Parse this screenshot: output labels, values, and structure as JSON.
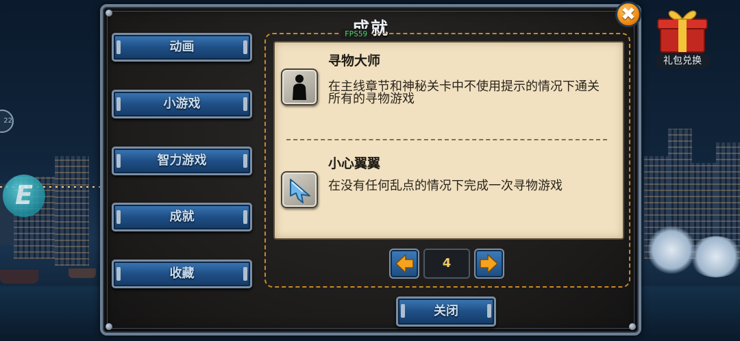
{
  "dialog": {
    "title": "成就",
    "close_icon_label": "✖",
    "fps_label": "FPS59"
  },
  "sidebar": {
    "items": [
      {
        "label": "动画"
      },
      {
        "label": "小游戏"
      },
      {
        "label": "智力游戏"
      },
      {
        "label": "成就"
      },
      {
        "label": "收藏"
      }
    ]
  },
  "achievements": [
    {
      "name": "寻物大师",
      "description": "在主线章节和神秘关卡中不使用提示的情况下通关所有的寻物游戏",
      "icon": "silhouette-icon"
    },
    {
      "name": "小心翼翼",
      "description": "在没有任何乱点的情况下完成一次寻物游戏",
      "icon": "cursor-arrow-icon"
    }
  ],
  "pager": {
    "current_page": "4",
    "prev_icon": "left-arrow-icon",
    "next_icon": "right-arrow-icon"
  },
  "footer": {
    "close_label": "关闭"
  },
  "background": {
    "gift_label": "礼包兑换",
    "badge_letter": "E",
    "left_circle_text": "22"
  },
  "colors": {
    "accent_orange": "#f08a12",
    "button_blue": "#1f4f86",
    "parchment": "#f1e1c1",
    "fps_green": "#49d36a"
  }
}
